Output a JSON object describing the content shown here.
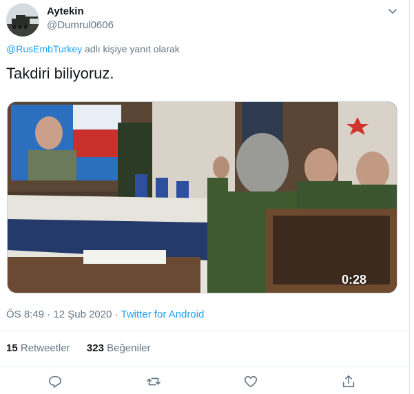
{
  "tweet": {
    "display_name": "Aytekin",
    "handle": "@Dumrul0606",
    "reply_prefix": "@RusEmbTurkey",
    "reply_suffix": " adlı kişiye yanıt olarak",
    "text": "Takdiri biliyoruz.",
    "video_duration": "0:28",
    "time": "ÖS 8:49 · 12 Şub 2020 · ",
    "source": "Twitter for Android",
    "retweet_count": "15",
    "retweet_label": "Retweetler",
    "like_count": "323",
    "like_label": "Beğeniler"
  },
  "colors": {
    "accent": "#1da1f2",
    "secondary_text": "#657786",
    "primary_text": "#14171a"
  },
  "icons": [
    "chevron-down-icon",
    "play-icon",
    "reply-icon",
    "retweet-icon",
    "like-icon",
    "share-icon"
  ]
}
